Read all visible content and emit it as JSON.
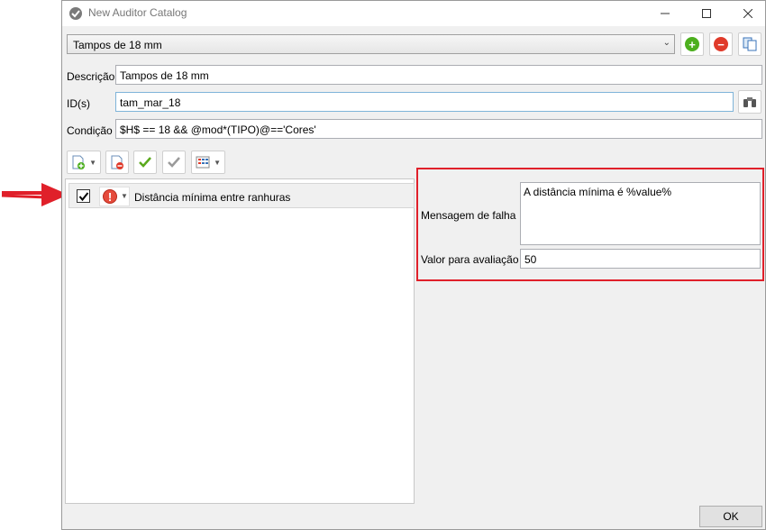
{
  "window": {
    "title": "New Auditor Catalog"
  },
  "catalog_select": {
    "value": "Tampos de 18 mm"
  },
  "toolbar_icons": {
    "add": "add-icon",
    "remove": "remove-icon",
    "copy": "copy-icon"
  },
  "fields": {
    "descricao": {
      "label": "Descrição",
      "value": "Tampos de 18 mm"
    },
    "ids": {
      "label": "ID(s)",
      "value": "tam_mar_18"
    },
    "condicao": {
      "label": "Condição",
      "value": "$H$ == 18 && @mod*(TIPO)@=='Cores'"
    }
  },
  "rules": [
    {
      "checked": true,
      "severity_icon": "error-icon",
      "label": "Distância mínima entre ranhuras"
    }
  ],
  "properties": {
    "mensagem": {
      "label": "Mensagem de falha",
      "value": "A distância mínima é %value%"
    },
    "valor": {
      "label": "Valor para avaliação",
      "value": "50"
    }
  },
  "ok_label": "OK",
  "colors": {
    "highlight": "#e0202a",
    "add": "#4caf1e",
    "remove": "#e03a2a"
  }
}
